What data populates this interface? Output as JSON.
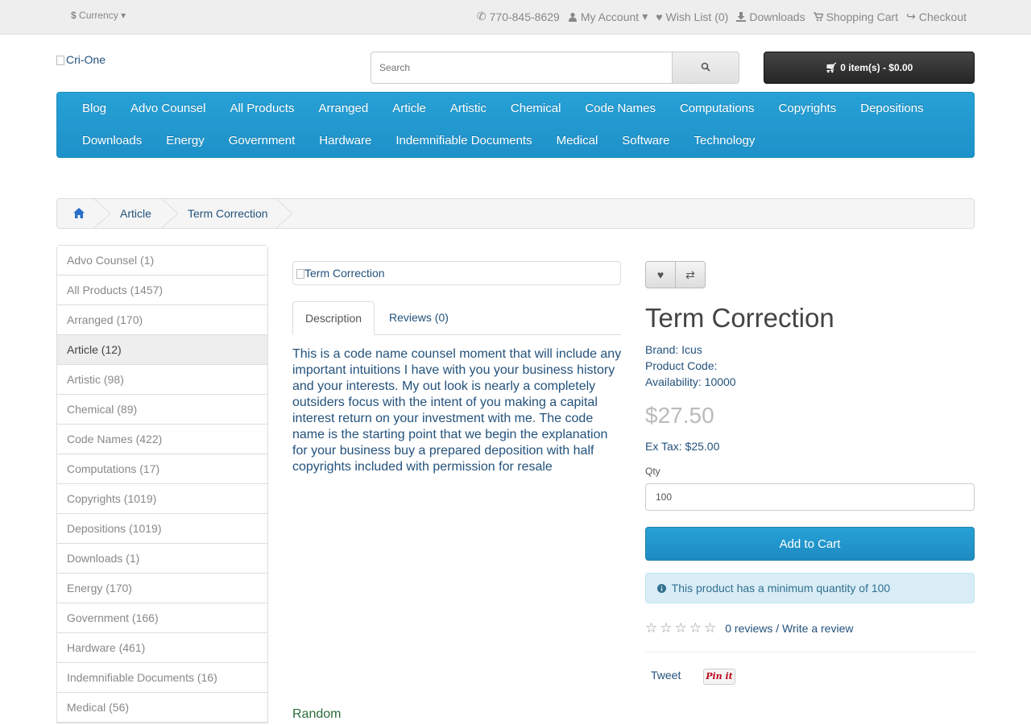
{
  "topbar": {
    "currency_symbol": "$",
    "currency_label": "Currency",
    "phone": "770-845-8629",
    "my_account": "My Account",
    "wishlist": "Wish List (0)",
    "downloads": "Downloads",
    "shopping_cart": "Shopping Cart",
    "checkout": "Checkout"
  },
  "header": {
    "logo_alt": "Cri-One",
    "search_placeholder": "Search",
    "cart_summary": "0 item(s) - $0.00"
  },
  "menu": {
    "row1": [
      "Blog",
      "Advo Counsel",
      "All Products",
      "Arranged",
      "Article",
      "Artistic",
      "Chemical",
      "Code Names",
      "Computations",
      "Copyrights",
      "Depositions"
    ],
    "row2": [
      "Downloads",
      "Energy",
      "Government",
      "Hardware",
      "Indemnifiable Documents",
      "Medical",
      "Software",
      "Technology"
    ]
  },
  "breadcrumb": {
    "items": [
      "Article",
      "Term Correction"
    ]
  },
  "sidebar": {
    "items": [
      {
        "label": "Advo Counsel (1)"
      },
      {
        "label": "All Products (1457)"
      },
      {
        "label": "Arranged (170)"
      },
      {
        "label": "Article (12)",
        "active": true
      },
      {
        "label": "Artistic (98)"
      },
      {
        "label": "Chemical (89)"
      },
      {
        "label": "Code Names (422)"
      },
      {
        "label": "Computations (17)"
      },
      {
        "label": "Copyrights (1019)"
      },
      {
        "label": "Depositions (1019)"
      },
      {
        "label": "Downloads (1)"
      },
      {
        "label": "Energy (170)"
      },
      {
        "label": "Government (166)"
      },
      {
        "label": "Hardware (461)"
      },
      {
        "label": "Indemnifiable Documents (16)"
      },
      {
        "label": "Medical (56)"
      }
    ]
  },
  "product": {
    "image_alt": "Term Correction",
    "tab_description": "Description",
    "tab_reviews": "Reviews (0)",
    "description": "This is a code name counsel moment that will include any important intuitions I have with you your business history and your interests. My out look is nearly a completely outsiders focus with the intent of you making a capital interest return on your investment with me. The code name is the starting point that we begin the explanation for your business buy a prepared deposition with half copyrights included with permission for resale",
    "random_heading": "Random",
    "title": "Term Correction",
    "brand": "Brand: Icus",
    "product_code": "Product Code:",
    "availability": "Availability: 10000",
    "price": "$27.50",
    "ex_tax": "Ex Tax: $25.00",
    "qty_label": "Qty",
    "qty_value": "100",
    "add_to_cart": "Add to Cart",
    "min_qty_notice": "This product has a minimum quantity of 100",
    "reviews_link": "0 reviews / Write a review",
    "rating_stars": 0,
    "tweet": "Tweet",
    "pin_it": "Pin it"
  },
  "colors": {
    "menu_blue": "#1e91c9",
    "link": "#23527c",
    "alert_bg": "#d9edf7"
  }
}
